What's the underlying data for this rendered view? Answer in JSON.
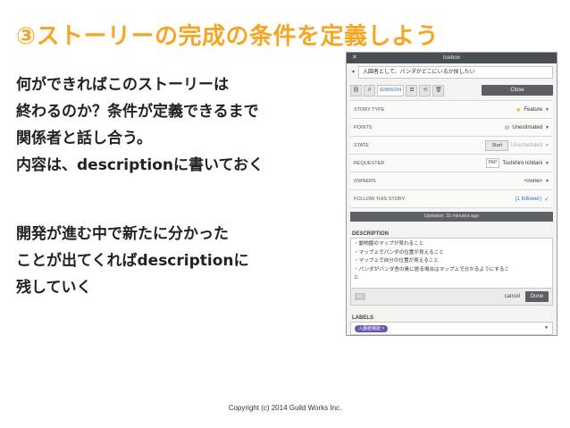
{
  "slide": {
    "title": "③ストーリーの完成の条件を定義しよう",
    "paragraph1": [
      "何ができればこのストーリーは",
      "終わるのか？条件が定義できるまで",
      "関係者と話し合う。",
      "内容は、descriptionに書いておく"
    ],
    "paragraph2": [
      "開発が進む中で新たに分かった",
      "ことが出てくればdescriptionに",
      "残していく"
    ],
    "copyright": "Copyright (c) 2014 Guild Works Inc."
  },
  "panel": {
    "window_title": "Icebox",
    "story_title": "入園者として、パンダがどこにいるか探したい",
    "story_id": "82806294",
    "close_label": "Close",
    "rows": {
      "story_type_label": "STORY TYPE",
      "story_type_value": "Feature",
      "points_label": "POINTS",
      "points_value": "Unestimated",
      "state_label": "STATE",
      "state_start": "Start",
      "state_value": "Unscheduled",
      "requester_label": "REQUESTER",
      "requester_initials": "PAP",
      "requester_value": "Toshihiro Ichitani",
      "owners_label": "OWNERS",
      "owners_value": "<none>",
      "follow_label": "FOLLOW THIS STORY",
      "follow_value": "(1 follower)"
    },
    "updated": "Updated: 15 minutes ago",
    "description_label": "DESCRIPTION",
    "description_lines": [
      "・動物園のマップが見れること",
      "・マップ上でパンダの位置が見えること",
      "・マップ上で自分の位置が見えること",
      "・パンダがパンダ舎の奥に居る場合はマップ上で分かるようにするこ",
      "と"
    ],
    "markdown_badge": "M↓",
    "cancel_label": "cancel",
    "done_label": "Done",
    "labels_label": "LABELS",
    "label_tag": "入園者機能 ×"
  }
}
